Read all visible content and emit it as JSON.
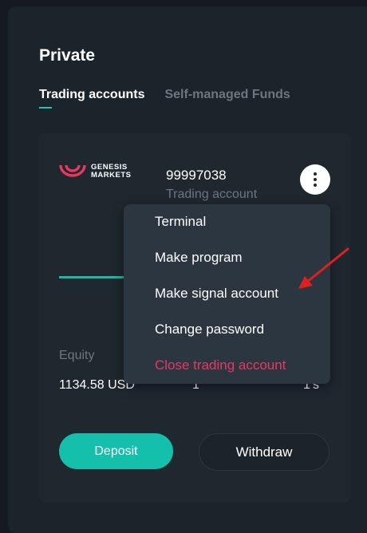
{
  "section": {
    "title": "Private"
  },
  "tabs": [
    {
      "label": "Trading accounts",
      "active": true
    },
    {
      "label": "Self-managed Funds",
      "active": false
    }
  ],
  "account": {
    "broker_logo_text": [
      "GENESIS",
      "MARKETS"
    ],
    "number": "99997038",
    "type": "Trading account",
    "equity_label": "Equity",
    "equity_value": "1134.58 USD",
    "column2_value": "1",
    "column3_value": "1's"
  },
  "menu": {
    "items": [
      {
        "label": "Terminal"
      },
      {
        "label": "Make program"
      },
      {
        "label": "Make signal account"
      },
      {
        "label": "Change password"
      },
      {
        "label": "Close trading account",
        "danger": true
      }
    ]
  },
  "actions": {
    "deposit": "Deposit",
    "withdraw": "Withdraw"
  },
  "colors": {
    "accent": "#14c0ab",
    "danger": "#e8385e",
    "logo": "#e8385e",
    "annotation_arrow": "#e02020"
  }
}
